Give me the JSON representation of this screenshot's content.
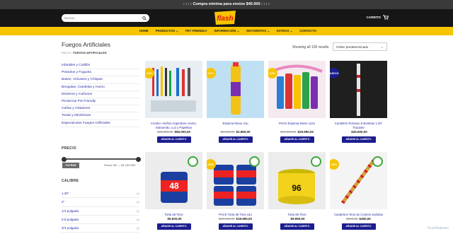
{
  "promo": ": : : : Compra minima para envíos $40.000 : : : :",
  "search": {
    "placeholder": "Buscar..."
  },
  "logo": "flash",
  "cart": "CARRITO",
  "nav": [
    "HOME",
    "PRODUCTOS",
    "PET FRIENDLY",
    "INFORMACIÓN",
    "MAYORISTAS",
    "EXTRAS",
    "CONTACTO"
  ],
  "page_title": "Fuegos Artificiales",
  "breadcrumb": {
    "home": "INICIO",
    "current": "FUEGOS ARTIFICIALES"
  },
  "result_count": "Showing all 130 results",
  "sort": "Orden predeterminado",
  "categories": [
    "Infantiles y Cotillón",
    "Petardos y Fogueta",
    "Bases, Volcanes y Chispas",
    "Bengalas, Candelas y Humo",
    "Morteros y Cañones",
    "Pirotecnia Pet Friendly",
    "Cañas y Voladores",
    "Tortas y MiniShows",
    "Espectáculos Fuegos Artificiales"
  ],
  "price_filter": {
    "title": "PRECIO",
    "button": "FILTRAR",
    "text": "Precio: $0 — $1.150.000"
  },
  "caliber": {
    "title": "CALIBRE",
    "items": [
      {
        "label": "1.30\"",
        "count": "(1)"
      },
      {
        "label": "2\"",
        "count": "(1)"
      },
      {
        "label": "1/4 pulgada",
        "count": "(1)"
      },
      {
        "label": "0.8 pulgada",
        "count": "(2)"
      },
      {
        "label": "3/4 pulgada",
        "count": "(1)"
      }
    ]
  },
  "add_label": "AÑADIR AL CARRITO",
  "products": [
    {
      "name": "Combo «Ireños Argentina» Humo, Estruendo, Luz y Papelitos",
      "old": "$65.000,00",
      "price": "$55.000,00",
      "badge": "-15%",
      "badge_color": "#f7c400"
    },
    {
      "name": "Espuma Nieve x1u",
      "old": "$3.500,00",
      "price": "$2.890,00",
      "badge": "-17%",
      "badge_color": "#f7c400"
    },
    {
      "name": "PACK Espuma Nieve x12u",
      "old": "$40.000,00",
      "price": "$29.990,00",
      "badge": "-25%",
      "badge_color": "#f7c400"
    },
    {
      "name": "Candelón Romano 8 Bombas 1.25\" Trazante",
      "old": "",
      "price": "$25.500,00",
      "badge": "NUEVO",
      "badge_color": "#1b1d8f"
    },
    {
      "name": "Torta 48 Tiros",
      "old": "",
      "price": "$5.500,00",
      "badge": "",
      "badge_color": ""
    },
    {
      "name": "PACK Torta 48 Tiros x4u",
      "old": "$20.000,00",
      "price": "$19.990,00",
      "badge": "-25%",
      "badge_color": "#f7c400"
    },
    {
      "name": "Torta 96 Tiros",
      "old": "",
      "price": "$9.990,00",
      "badge": "",
      "badge_color": ""
    },
    {
      "name": "Candela 5 Tiros de Colores Surtidos",
      "old": "$900,00",
      "price": "$490,00",
      "badge": "-46%",
      "badge_color": "#f7c400"
    }
  ],
  "watermark": "ScanMalware"
}
